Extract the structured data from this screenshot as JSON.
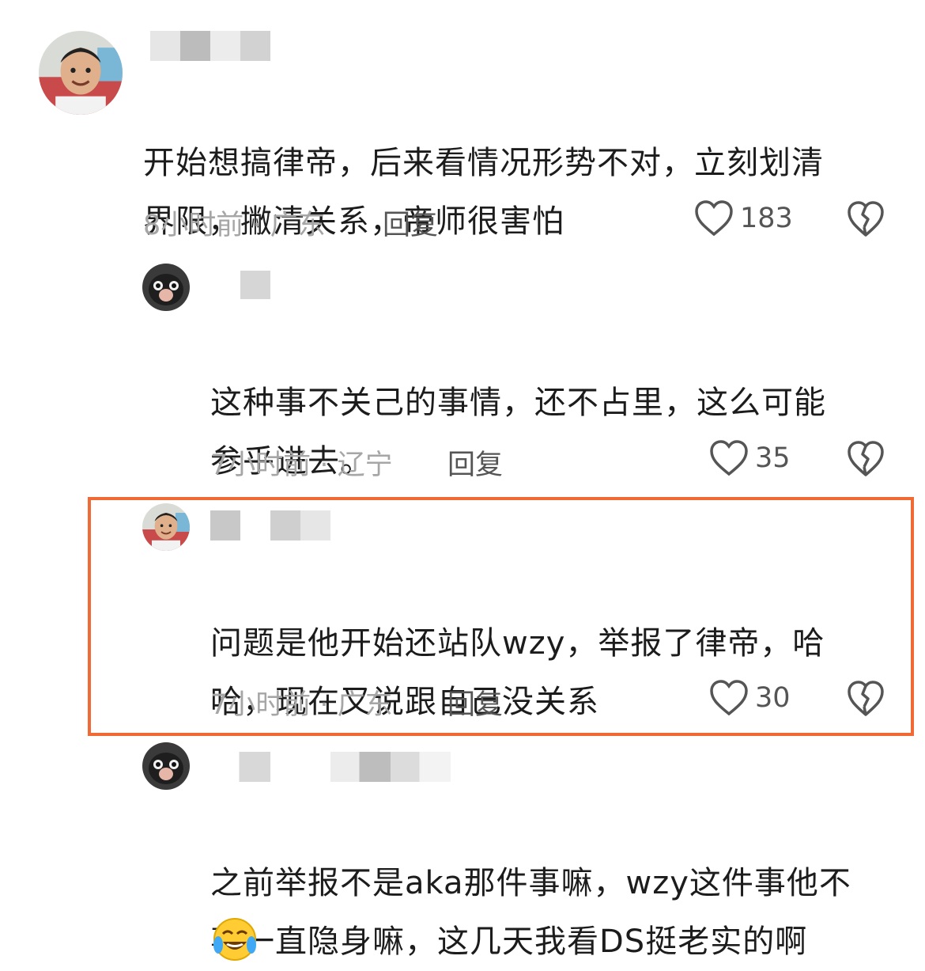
{
  "comments": [
    {
      "text_line1": "开始想搞律帝，后来看情况形势不对，立刻划清",
      "text_line2": "界限，撇清关系，帝师很害怕",
      "meta": "8小时前 · 广东",
      "reply_label": "回复",
      "likes": "183"
    },
    {
      "text_line1": "这种事不关己的事情，还不占里，这么可能",
      "text_line2": "参乎进去。",
      "meta": "7小时前 · 辽宁",
      "reply_label": "回复",
      "likes": "35"
    },
    {
      "text_line1": "问题是他开始还站队wzy，举报了律帝，哈",
      "text_line2": "哈，现在又说跟自己没关系",
      "meta": "7小时前 · 广东",
      "reply_label": "回复",
      "likes": "30",
      "highlight_color": "#f06a35"
    },
    {
      "text_line1": "之前举报不是aka那件事嘛，wzy这件事他不",
      "text_line2": "事一直隐身嘛，这几天我看DS挺老实的啊",
      "emoji": "laugh-cry-emoji"
    }
  ]
}
